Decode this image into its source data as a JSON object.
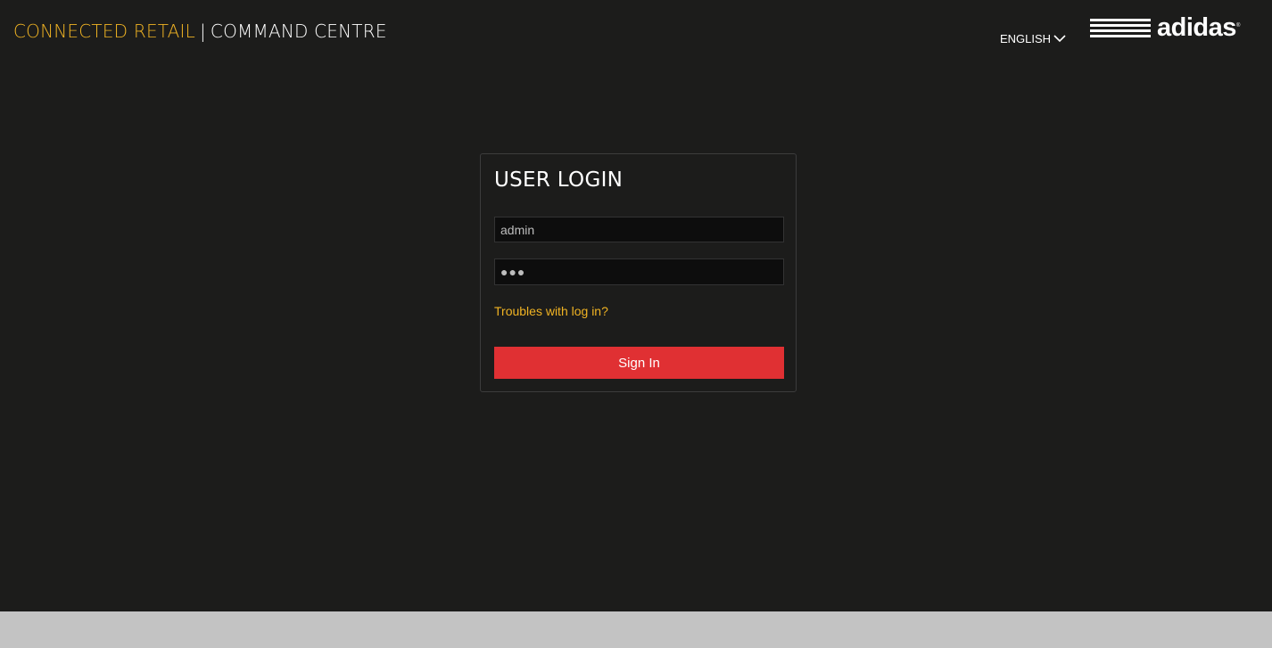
{
  "header": {
    "brand_accent": "CONNECTED RETAIL",
    "separator": "|",
    "brand_main": "COMMAND CENTRE",
    "language": "ENGLISH",
    "language_icon": "chevron-down-icon",
    "logo_text": "adidas",
    "logo_mark": "®"
  },
  "login": {
    "title": "USER LOGIN",
    "username_value": "admin",
    "password_value": "●●●",
    "trouble_link": "Troubles with log in?",
    "signin_label": "Sign In"
  },
  "colors": {
    "background": "#1c1c1b",
    "accent": "#f0b323",
    "button": "#e03033",
    "footer": "#c3c3c3"
  }
}
